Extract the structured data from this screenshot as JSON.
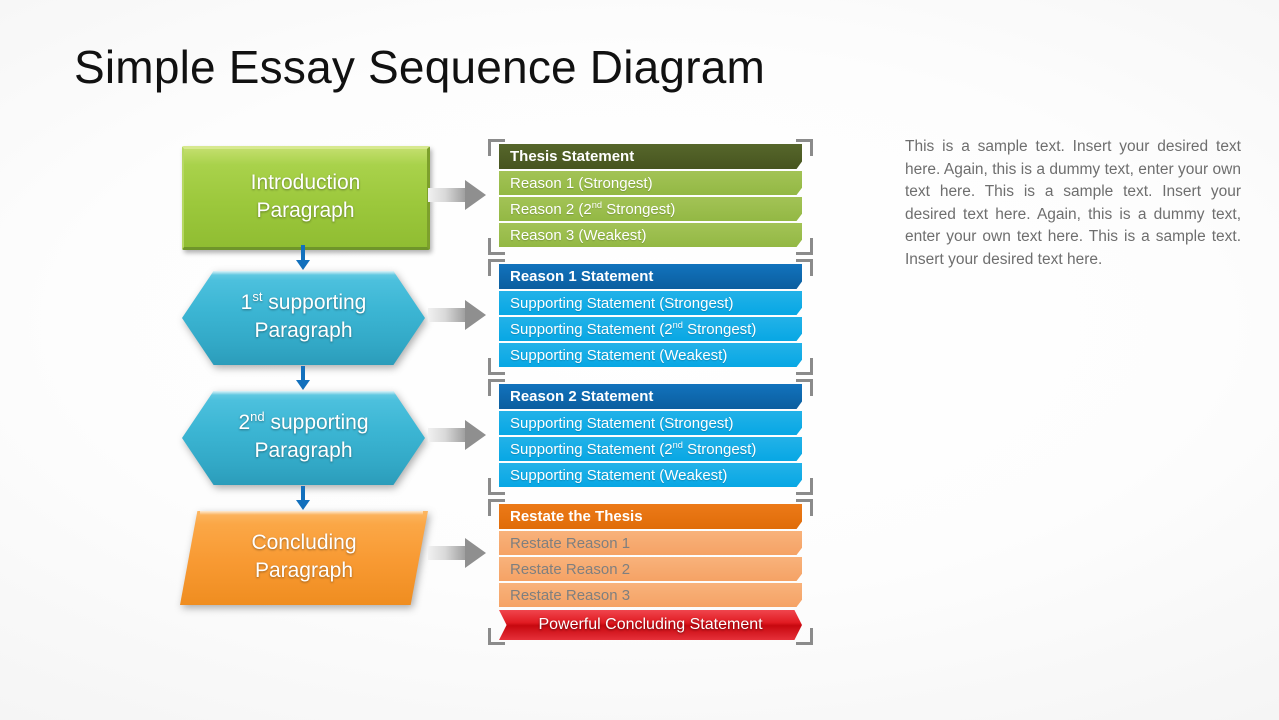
{
  "title": "Simple Essay Sequence Diagram",
  "flow": {
    "steps": [
      {
        "name": "introduction",
        "label_html": "Introduction<br>Paragraph",
        "shape": "rectangle",
        "color": "#9cc83c"
      },
      {
        "name": "first-supporting",
        "label_html": "1<sup>st</sup> supporting<br>Paragraph",
        "shape": "hexagon",
        "color": "#3cb6d4"
      },
      {
        "name": "second-supporting",
        "label_html": "2<sup>nd</sup> supporting<br>Paragraph",
        "shape": "hexagon",
        "color": "#3cb6d4"
      },
      {
        "name": "concluding",
        "label_html": "Concluding<br>Paragraph",
        "shape": "parallelogram",
        "color": "#f89a33"
      }
    ]
  },
  "groups": [
    {
      "name": "thesis-group",
      "theme": "green",
      "header": "Thesis Statement",
      "items": [
        "Reason 1 (Strongest)",
        "Reason 2 (2<sup>nd</sup> Strongest)",
        "Reason 3 (Weakest)"
      ]
    },
    {
      "name": "reason-1-group",
      "theme": "blue",
      "header": "Reason 1 Statement",
      "items": [
        "Supporting Statement (Strongest)",
        "Supporting Statement (2<sup>nd</sup> Strongest)",
        "Supporting Statement (Weakest)"
      ]
    },
    {
      "name": "reason-2-group",
      "theme": "blue",
      "header": "Reason 2 Statement",
      "items": [
        "Supporting Statement (Strongest)",
        "Supporting Statement (2<sup>nd</sup> Strongest)",
        "Supporting Statement (Weakest)"
      ]
    },
    {
      "name": "conclusion-group",
      "theme": "orange",
      "header": "Restate the Thesis",
      "items": [
        "Restate Reason 1",
        "Restate Reason 2",
        "Restate Reason 3"
      ],
      "banner": "Powerful Concluding Statement"
    }
  ],
  "side_text": "This is a sample text. Insert your desired text here. Again, this is a dummy text, enter your own text here. This is a sample text. Insert your desired text here. Again, this is a dummy text, enter your own text here. This is a sample text. Insert your desired text here.",
  "colors": {
    "green_header": "#47551f",
    "green_item": "#9cc83c",
    "blue_header": "#0b5e9f",
    "blue_item": "#07a7e4",
    "orange_header": "#e06c09",
    "orange_item": "#f5a265",
    "red_banner": "#e11b22",
    "connector_arrow": "#1270bd",
    "gray_arrow": "#8f8f8f",
    "bracket": "#8b8b8b",
    "title_text": "#111111",
    "side_text": "#6e6e6e"
  }
}
